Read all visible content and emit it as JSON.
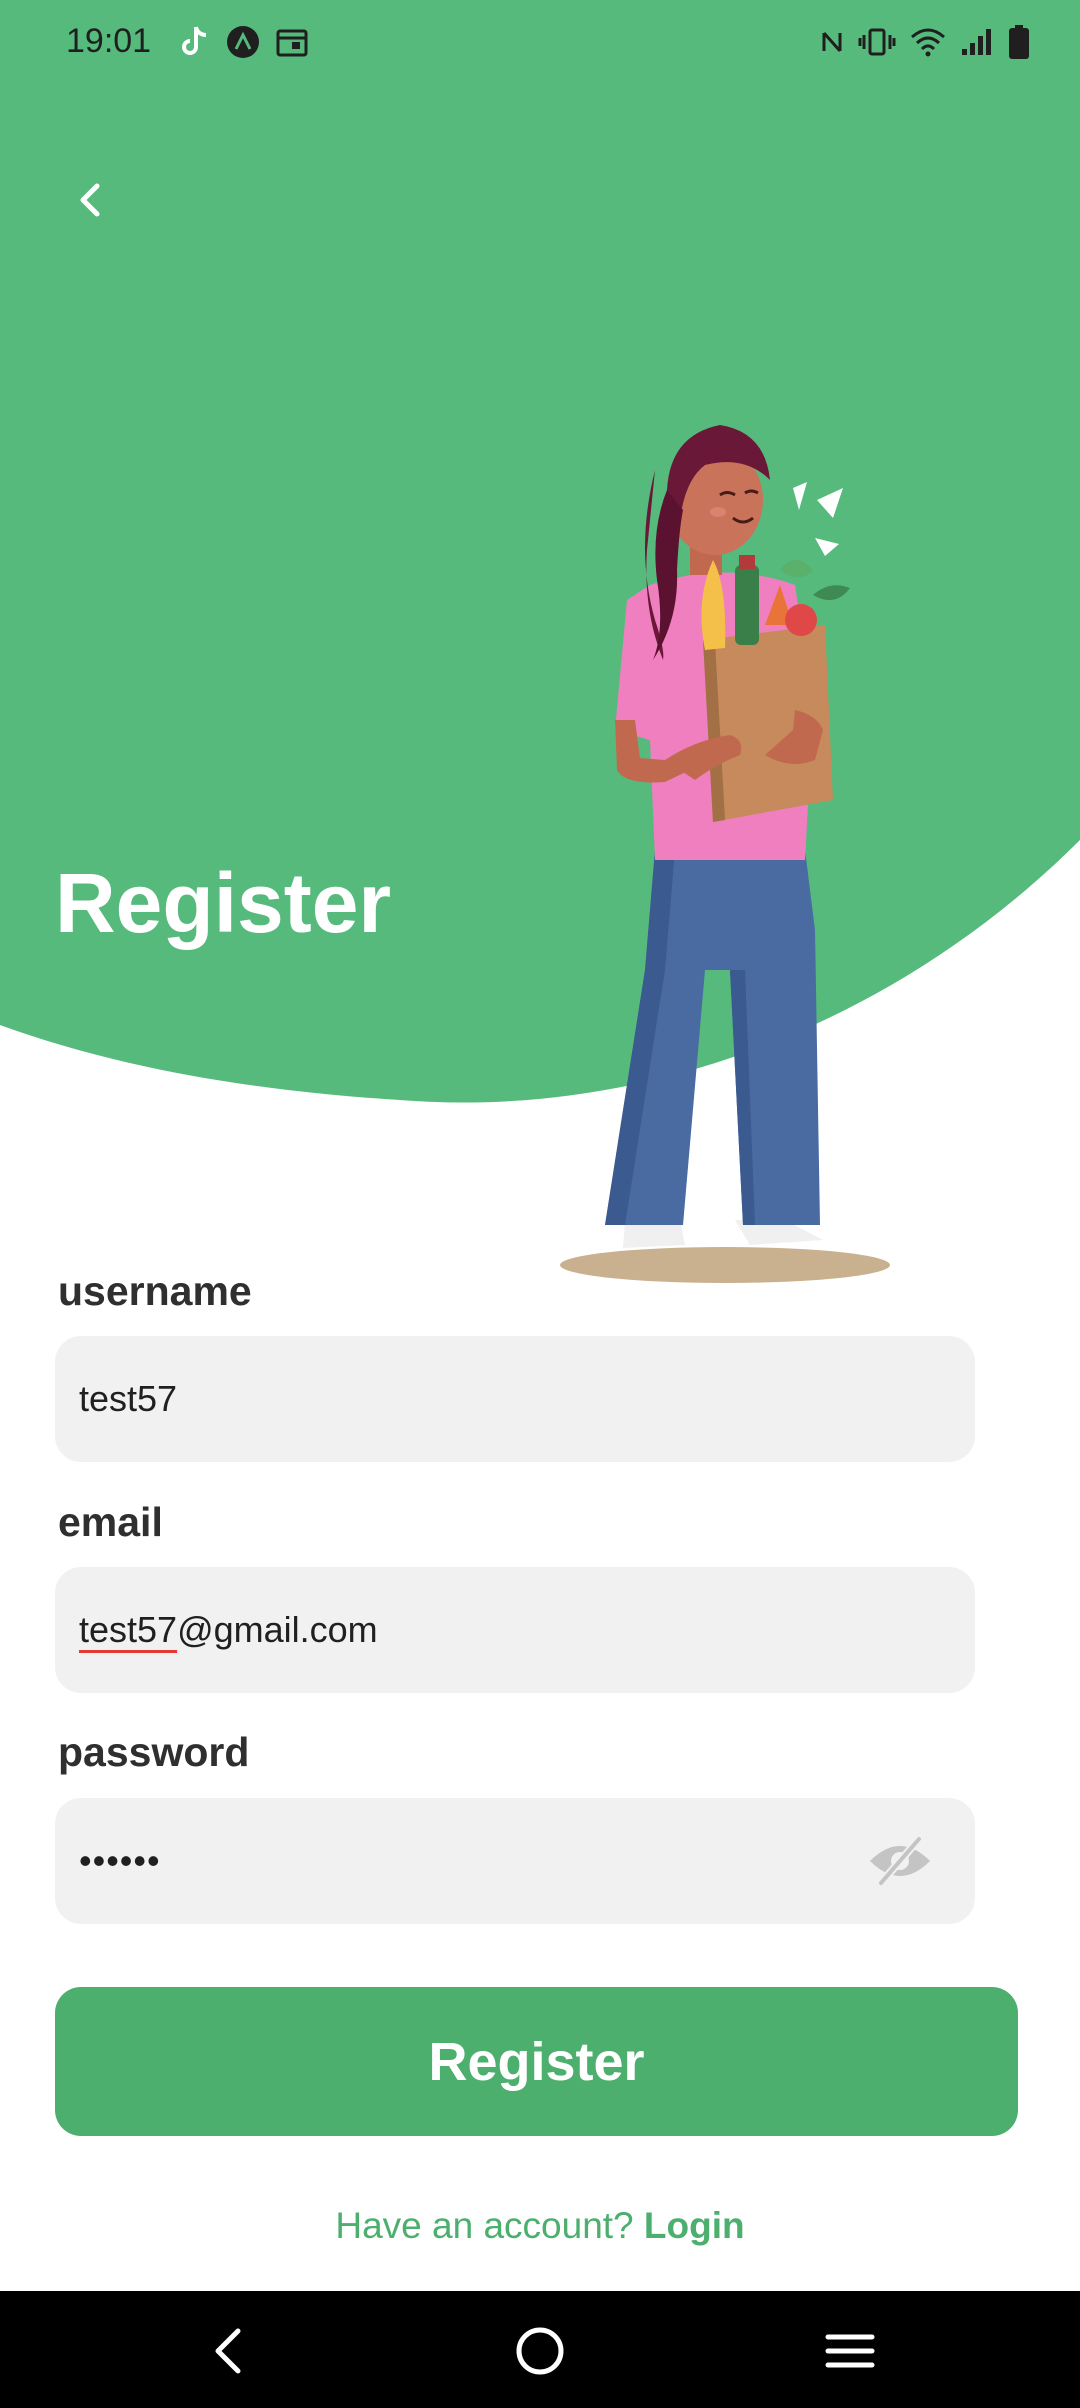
{
  "status_bar": {
    "time": "19:01",
    "left_icons": [
      "tiktok-icon",
      "app-notification-icon",
      "calendar-icon"
    ],
    "right_icons": [
      "nfc-icon",
      "vibrate-icon",
      "wifi-icon",
      "signal-icon",
      "battery-icon"
    ]
  },
  "header": {
    "back_icon": "chevron-left-icon",
    "title": "Register",
    "illustration": "woman-holding-grocery-bag"
  },
  "form": {
    "username": {
      "label": "username",
      "value": "test57"
    },
    "email": {
      "label": "email",
      "value_part1": "test57",
      "value_part2": "@gmail.com"
    },
    "password": {
      "label": "password",
      "value": "••••••",
      "toggle_icon": "eye-off-icon"
    },
    "submit_label": "Register"
  },
  "footer": {
    "prompt": "Have an account?",
    "link": "Login"
  },
  "nav_bar": {
    "icons": [
      "nav-back-icon",
      "nav-home-icon",
      "nav-menu-icon"
    ]
  },
  "colors": {
    "primary_green": "#57ba7d",
    "button_green": "#4caf6e",
    "field_bg": "#f1f1f1",
    "text_dark": "#2f2f2f"
  }
}
